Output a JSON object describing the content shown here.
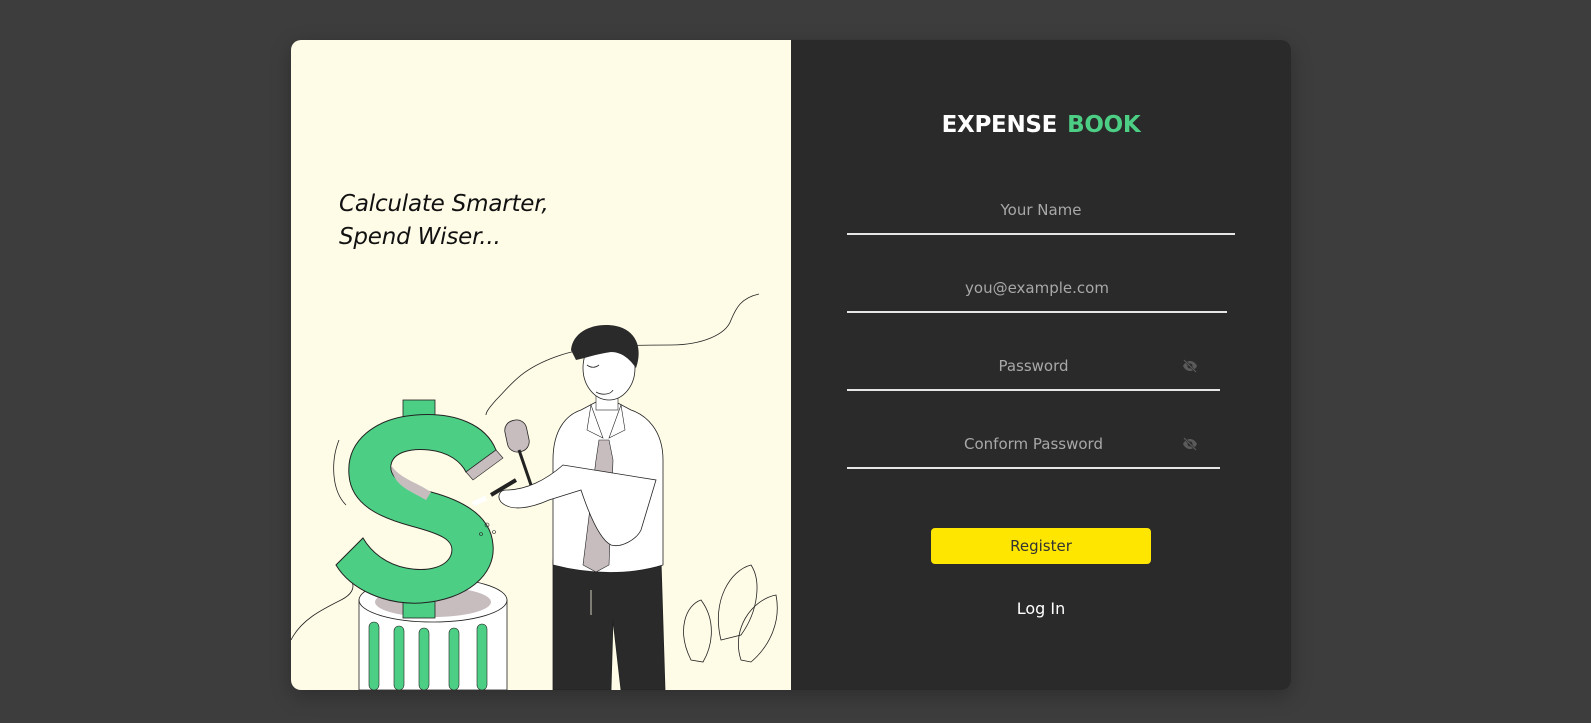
{
  "hero": {
    "tagline_line1": "Calculate Smarter,",
    "tagline_line2": "Spend Wiser..."
  },
  "brand": {
    "word1": "EXPENSE",
    "word2": "BOOK",
    "accent_color": "#4cce85"
  },
  "form": {
    "name_placeholder": "Your Name",
    "email_placeholder": "you@example.com",
    "password_placeholder": "Password",
    "confirm_placeholder": "Conform Password",
    "password_toggle_icon": "eye-slash-icon",
    "register_label": "Register",
    "register_color": "#ffe600",
    "login_label": "Log In"
  },
  "colors": {
    "background": "#3d3d3d",
    "left_panel": "#fefbe6",
    "right_panel": "#2a2a2a"
  }
}
